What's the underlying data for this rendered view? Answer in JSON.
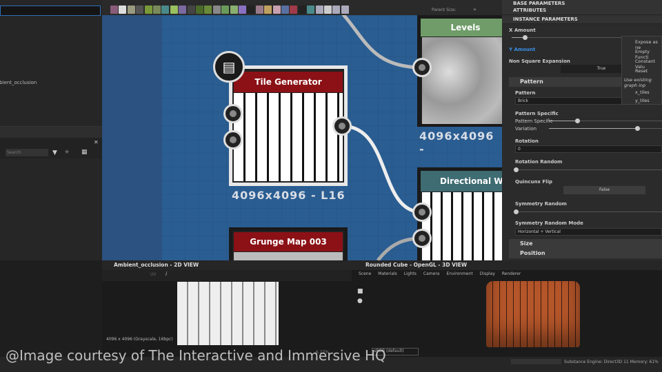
{
  "left_panel": {
    "tree_item": "ambient_occlusion",
    "search_placeholder": "Search"
  },
  "toolbar": {
    "parent_size_label": "Parent Size:",
    "more": "»"
  },
  "graph": {
    "nodes": [
      {
        "title": "Tile Generator",
        "resolution": "4096x4096 - L16",
        "header_color": "#8b1116"
      },
      {
        "title": "Levels",
        "resolution": "4096x4096 -",
        "header_color": "#6f9c68"
      },
      {
        "title": "Directional Wa",
        "header_color": "#3f6b72"
      },
      {
        "title": "Grunge Map 003",
        "header_color": "#8b1116"
      }
    ]
  },
  "properties": {
    "sections": [
      "BASE PARAMETERS",
      "ATTRIBUTES",
      "INSTANCE PARAMETERS"
    ],
    "x_amount": "X Amount",
    "y_amount": "Y Amount",
    "non_square": "Non Square Expansion",
    "non_square_value": "True",
    "pattern_group": "Pattern",
    "pattern_label": "Pattern",
    "pattern_value": "Brick",
    "pattern_specific_group": "Pattern Specific",
    "pattern_specific": "Pattern Specific",
    "variation": "Variation",
    "rotation": "Rotation",
    "rotation_value": "0",
    "rotation_random": "Rotation Random",
    "quincunx": "Quincunx Flip",
    "quincunx_value": "False",
    "symmetry_random": "Symmetry Random",
    "symmetry_mode": "Symmetry Random Mode",
    "symmetry_mode_value": "Horizontal + Vertical",
    "size_group": "Size",
    "position_group": "Position",
    "slider_values": {
      "x_amount": 0.12,
      "pattern_specific": 0.25,
      "variation": 0.78,
      "rotation_random": 0,
      "symmetry_random": 0
    }
  },
  "context_menu": {
    "items": [
      "Expose as ne",
      "Empty Functi",
      "Constant Valu",
      "Reset"
    ],
    "hint": "Use existing graph inp",
    "inputs": [
      "x_tiles",
      "y_tiles"
    ]
  },
  "view2d": {
    "title": "Ambient_occlusion - 2D VIEW",
    "info": "4096 x 4096 (Grayscale, 16bpc)",
    "zoom": "6.27%",
    "uv": "UV"
  },
  "view3d": {
    "title": "Rounded Cube - OpenGL - 3D VIEW",
    "menu": [
      "Scene",
      "Materials",
      "Lights",
      "Camera",
      "Environment",
      "Display",
      "Renderer"
    ],
    "colorspace": "sRGB (default)"
  },
  "status": {
    "engine": "Substance Engine: Direct3D 11  Memory: 61%"
  },
  "watermark": "@Image courtesy of The Interactive and Immersive HQ"
}
